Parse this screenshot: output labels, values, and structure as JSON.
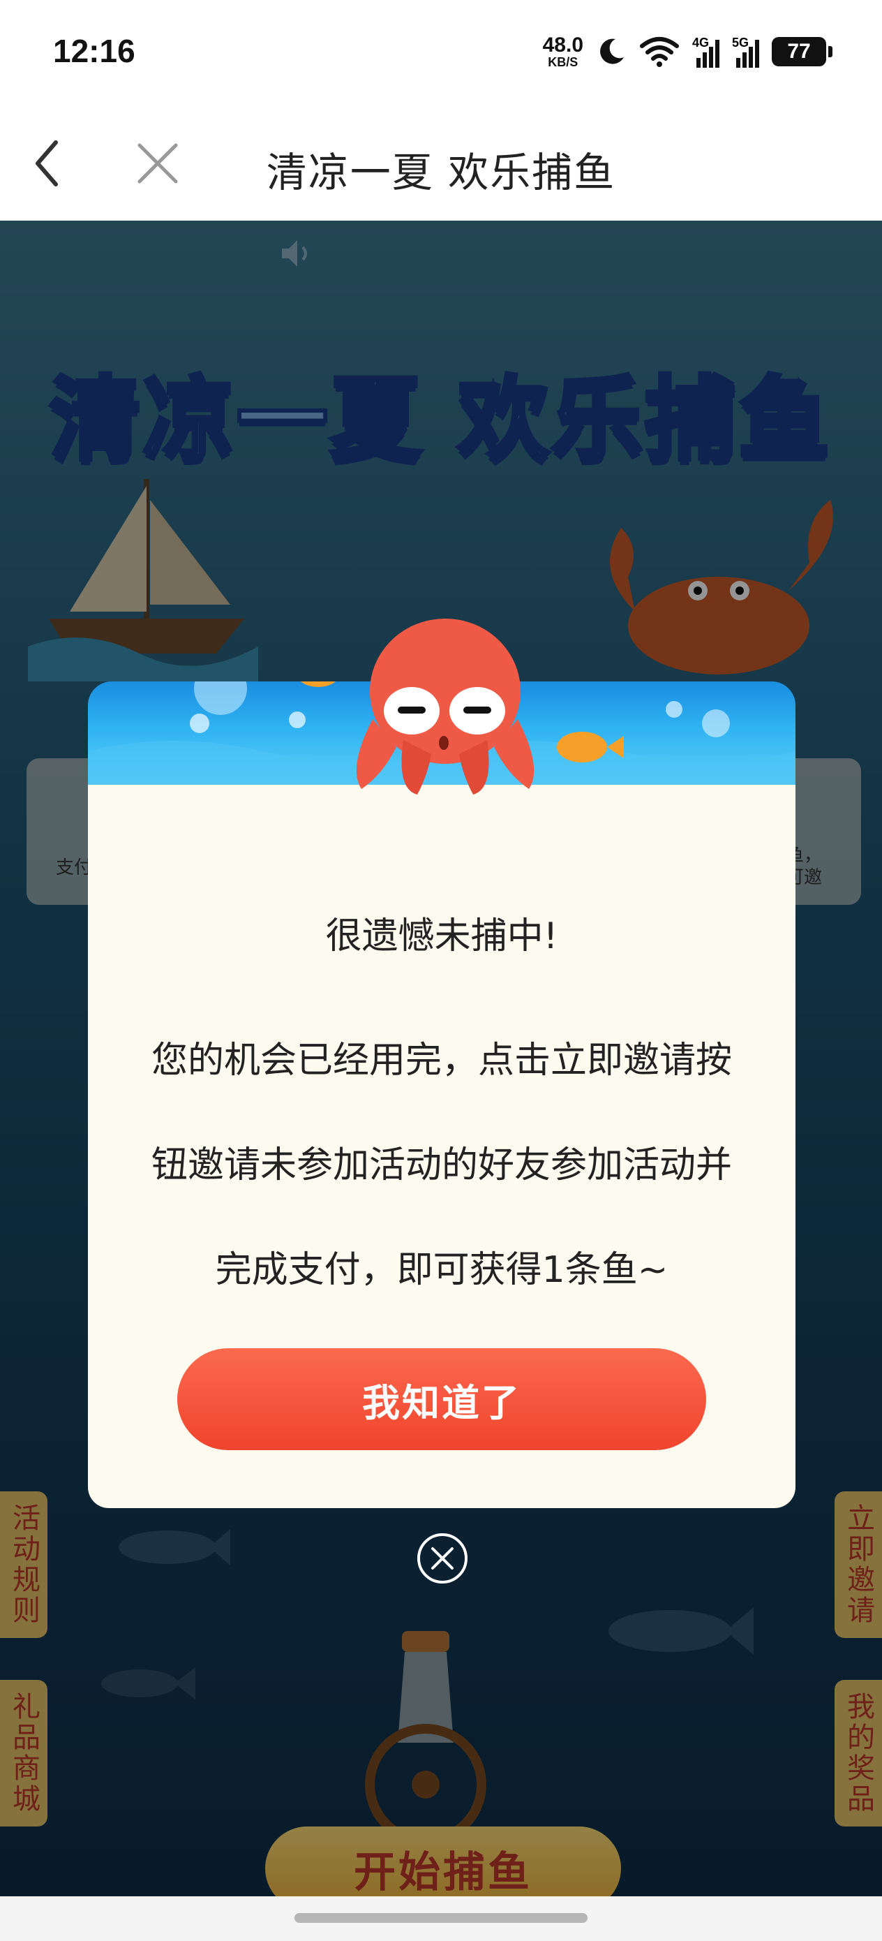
{
  "status_bar": {
    "time": "12:16",
    "net_speed_value": "48.0",
    "net_speed_unit": "KB/S",
    "signal_1": "4G",
    "signal_2": "5G",
    "battery": "77"
  },
  "nav": {
    "title": "清凉一夏 欢乐捕鱼"
  },
  "hero": {
    "title": "清凉一夏 欢乐捕鱼"
  },
  "side_cards": {
    "left_text": "支付",
    "right_text_1": "捕鱼，",
    "right_text_2": "多可邀"
  },
  "side_tabs": {
    "rules": "活动规则",
    "mall": "礼品商城",
    "invite": "立即邀请",
    "prize": "我的奖品"
  },
  "start_button": "开始捕鱼",
  "modal": {
    "title": "很遗憾未捕中!",
    "line1": "您的机会已经用完，点击立即邀请按",
    "line2": "钮邀请未参加活动的好友参加活动并",
    "line3": "完成支付，即可获得1条鱼~",
    "confirm_label": "我知道了"
  },
  "colors": {
    "confirm_button": "#f0442d",
    "modal_body": "#fdfaf0",
    "modal_header": "#2fb3f2",
    "octopus": "#ef5a46"
  },
  "icons": [
    "back-arrow-icon",
    "close-icon",
    "speaker-icon",
    "wifi-icon",
    "moon-icon",
    "signal-icon",
    "battery-icon",
    "dialog-close-icon"
  ]
}
